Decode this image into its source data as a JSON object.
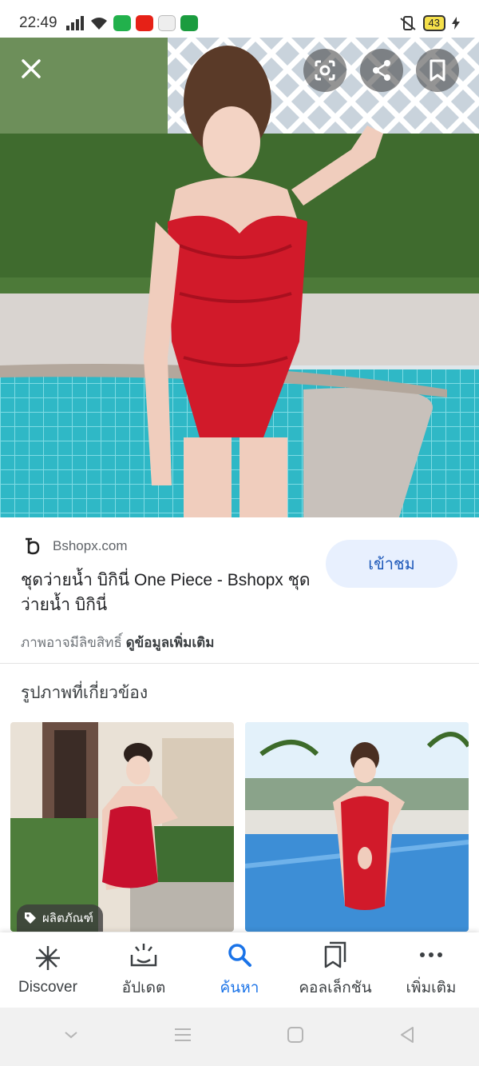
{
  "status_bar": {
    "time": "22:49",
    "battery": "43"
  },
  "hero": {
    "close_icon": "close-icon",
    "lens_icon": "google-lens-icon",
    "share_icon": "share-icon",
    "bookmark_icon": "bookmark-icon"
  },
  "result": {
    "source": "Bshopx.com",
    "title": "ชุดว่ายน้ำ บิกินี่ One Piece - Bshopx ชุดว่ายน้ำ บิกินี่",
    "visit_label": "เข้าชม",
    "copyright_text": "ภาพอาจมีลิขสิทธิ์",
    "more_info_label": "ดูข้อมูลเพิ่มเติม"
  },
  "related": {
    "title": "รูปภาพที่เกี่ยวข้อง",
    "product_badge": "ผลิตภัณฑ์"
  },
  "bottom_nav": {
    "items": [
      {
        "label": "Discover",
        "icon": "asterisk-icon"
      },
      {
        "label": "อัปเดต",
        "icon": "updates-icon"
      },
      {
        "label": "ค้นหา",
        "icon": "search-icon"
      },
      {
        "label": "คอลเล็กชัน",
        "icon": "collections-icon"
      },
      {
        "label": "เพิ่มเติม",
        "icon": "more-icon"
      }
    ]
  },
  "colors": {
    "accent": "#1a73e8",
    "visit_bg": "#e8f0fe"
  }
}
